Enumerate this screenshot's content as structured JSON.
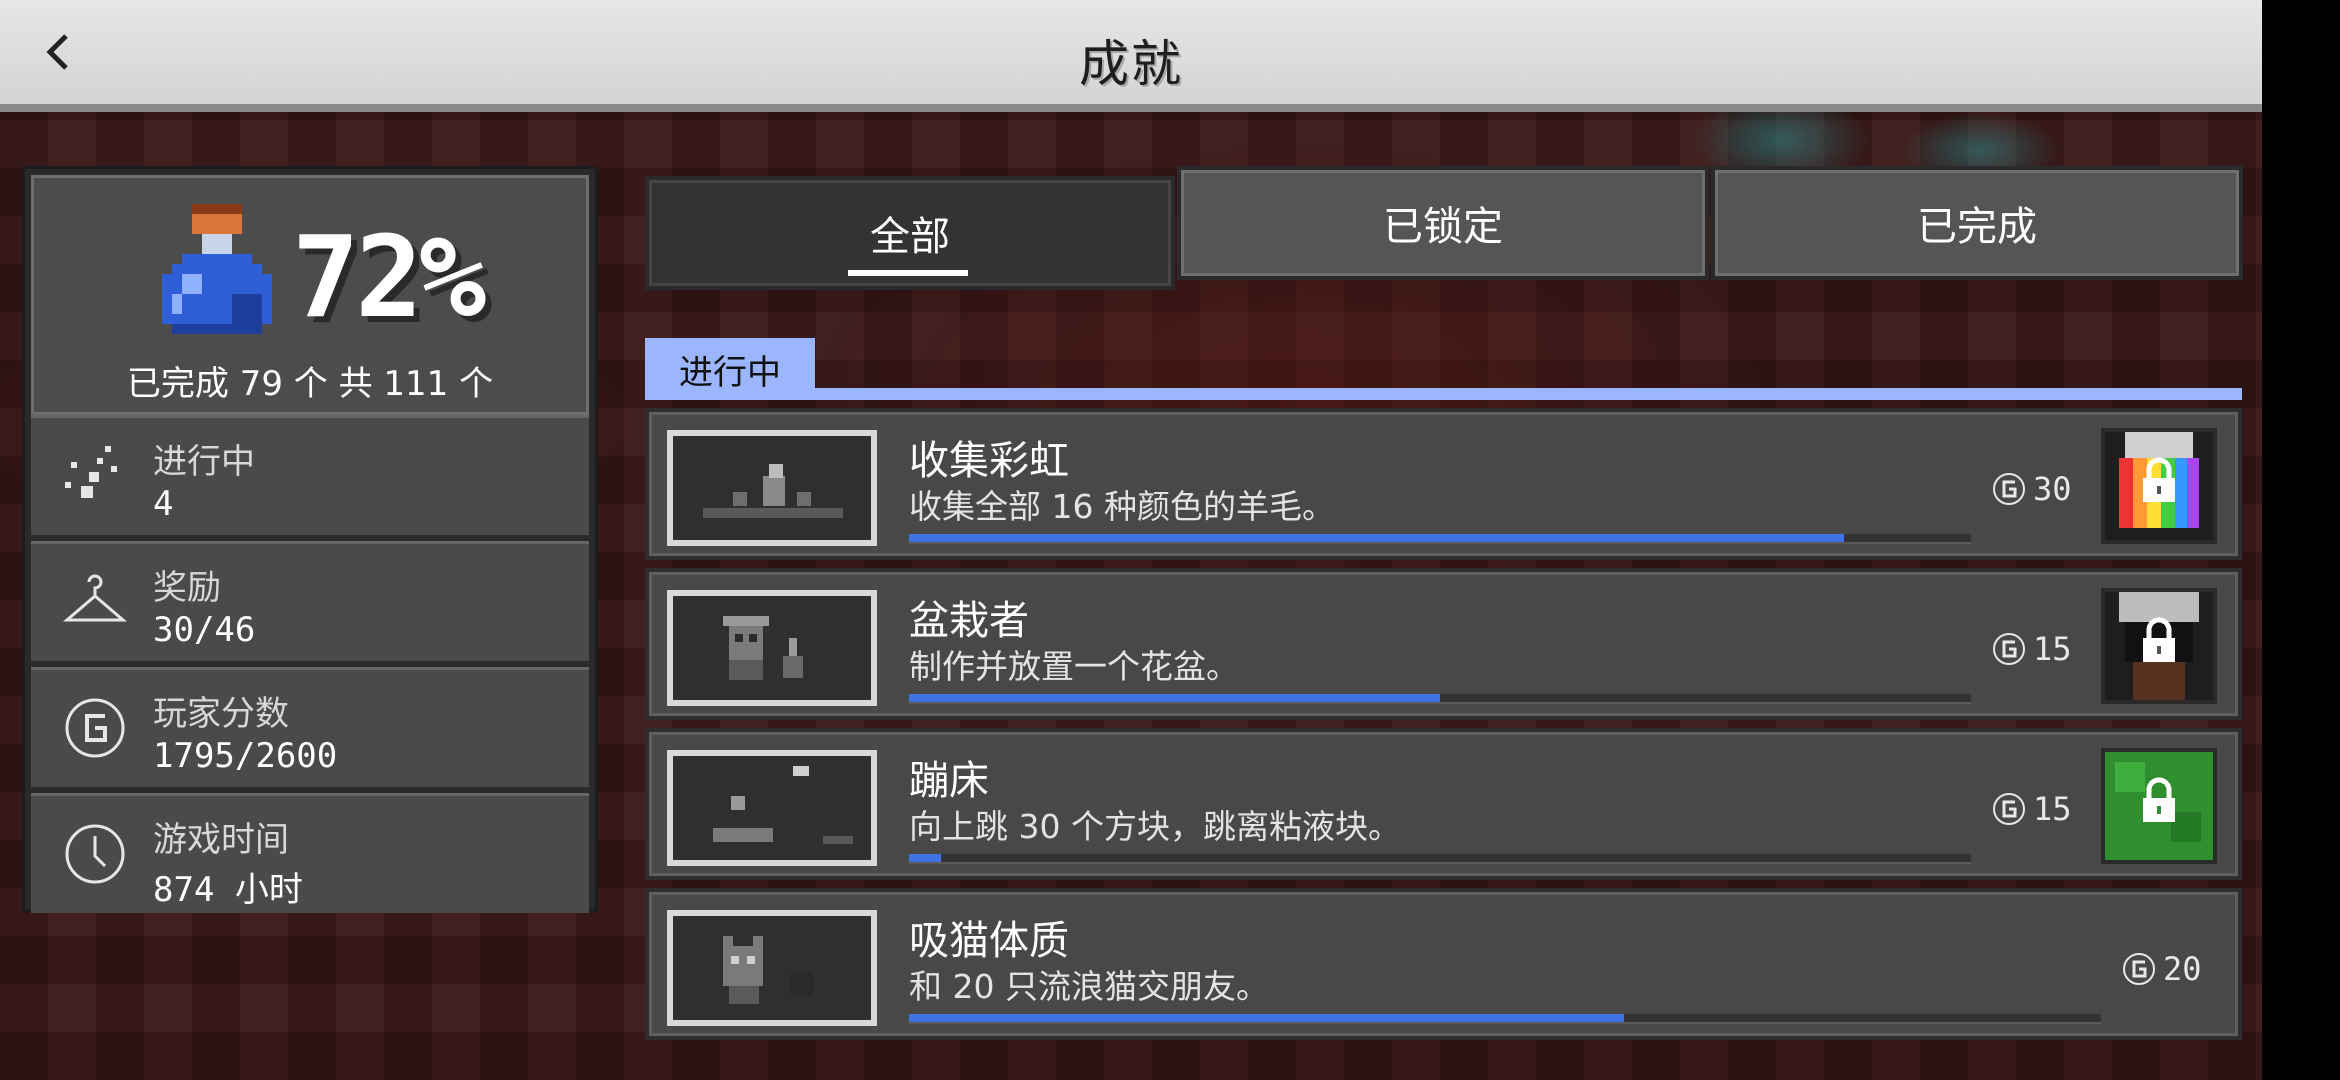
{
  "header": {
    "title": "成就",
    "back_icon": "chevron-left-icon"
  },
  "summary": {
    "percent": "72%",
    "completed_text": "已完成 79 个 共 111 个",
    "icon": "potion-icon"
  },
  "stats": [
    {
      "label": "进行中",
      "value": "4",
      "icon": "sparkle-icon"
    },
    {
      "label": "奖励",
      "value": "30/46",
      "icon": "hanger-icon"
    },
    {
      "label": "玩家分数",
      "value": "1795/2600",
      "icon": "gamerscore-icon"
    },
    {
      "label": "游戏时间",
      "value": "874 小时",
      "icon": "clock-icon"
    }
  ],
  "tabs": [
    {
      "label": "全部",
      "active": true
    },
    {
      "label": "已锁定",
      "active": false
    },
    {
      "label": "已完成",
      "active": false
    }
  ],
  "section": {
    "label": "进行中",
    "color": "#9bb6ff"
  },
  "achievements": [
    {
      "title": "收集彩虹",
      "description": "收集全部 16 种颜色的羊毛。",
      "points": "30",
      "progress": 0.88,
      "reward": "rainbow-cape-locked"
    },
    {
      "title": "盆栽者",
      "description": "制作并放置一个花盆。",
      "points": "15",
      "progress": 0.5,
      "reward": "hat-locked"
    },
    {
      "title": "蹦床",
      "description": "向上跳 30 个方块，跳离粘液块。",
      "points": "15",
      "progress": 0.03,
      "reward": "slime-head-locked"
    },
    {
      "title": "吸猫体质",
      "description": "和 20 只流浪猫交朋友。",
      "points": "20",
      "progress": 0.6,
      "reward": null
    }
  ],
  "colors": {
    "progress": "#3d73e6",
    "panel": "#484848",
    "accent": "#9bb6ff"
  }
}
